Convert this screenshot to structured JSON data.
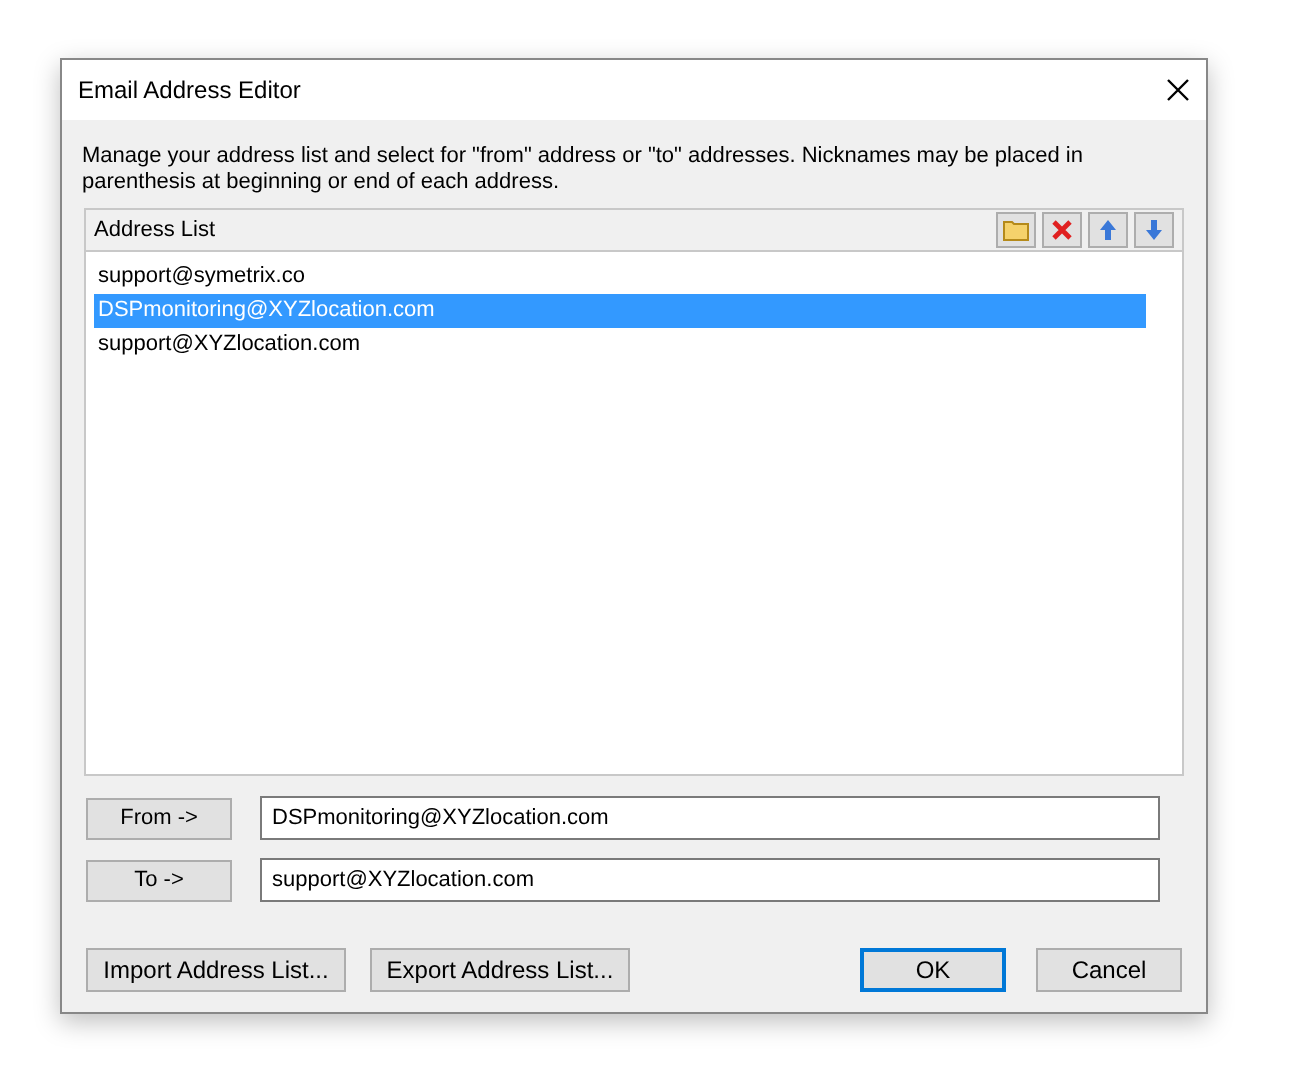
{
  "window": {
    "title": "Email Address Editor"
  },
  "description": "Manage your address list and select for \"from\" address or \"to\" addresses.  Nicknames may be placed in parenthesis at beginning or end of each address.",
  "address_list": {
    "title": "Address List",
    "items": [
      {
        "text": "support@symetrix.co",
        "selected": false
      },
      {
        "text": "DSPmonitoring@XYZlocation.com",
        "selected": true
      },
      {
        "text": "support@XYZlocation.com",
        "selected": false
      }
    ]
  },
  "from": {
    "button": "From ->",
    "value": "DSPmonitoring@XYZlocation.com"
  },
  "to": {
    "button": "To ->",
    "value": "support@XYZlocation.com"
  },
  "buttons": [
    {
      "label": "Import Address List...",
      "default": false
    },
    {
      "label": "Export Address List...",
      "default": false
    },
    {
      "label": "OK",
      "default": true
    },
    {
      "label": "Cancel",
      "default": false
    }
  ]
}
